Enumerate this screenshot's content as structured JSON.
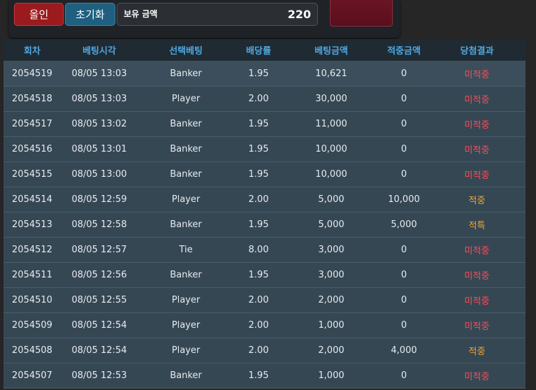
{
  "controls": {
    "allin_label": "올인",
    "reset_label": "초기화",
    "balance_label": "보유 금액",
    "balance_value": "220",
    "bet_label": ""
  },
  "colors": {
    "allin_button": "#9a1a1d",
    "reset_button": "#1f5f80",
    "bet_button": "#6a1424",
    "header_text": "#4fa8e0",
    "loss_text": "#ff4a55",
    "win_text": "#f0a531"
  },
  "table": {
    "headers": [
      "회차",
      "베팅시각",
      "선택베팅",
      "배당률",
      "베팅금액",
      "적중금액",
      "당첨결과"
    ],
    "rows": [
      {
        "round": "2054519",
        "time": "08/05 13:03",
        "choice": "Banker",
        "odds": "1.95",
        "amount": "10,621",
        "win": "0",
        "result": "미적중",
        "status": "lose"
      },
      {
        "round": "2054518",
        "time": "08/05 13:03",
        "choice": "Player",
        "odds": "2.00",
        "amount": "30,000",
        "win": "0",
        "result": "미적중",
        "status": "lose"
      },
      {
        "round": "2054517",
        "time": "08/05 13:02",
        "choice": "Banker",
        "odds": "1.95",
        "amount": "11,000",
        "win": "0",
        "result": "미적중",
        "status": "lose"
      },
      {
        "round": "2054516",
        "time": "08/05 13:01",
        "choice": "Banker",
        "odds": "1.95",
        "amount": "10,000",
        "win": "0",
        "result": "미적중",
        "status": "lose"
      },
      {
        "round": "2054515",
        "time": "08/05 13:00",
        "choice": "Banker",
        "odds": "1.95",
        "amount": "10,000",
        "win": "0",
        "result": "미적중",
        "status": "lose"
      },
      {
        "round": "2054514",
        "time": "08/05 12:59",
        "choice": "Player",
        "odds": "2.00",
        "amount": "5,000",
        "win": "10,000",
        "result": "적중",
        "status": "win"
      },
      {
        "round": "2054513",
        "time": "08/05 12:58",
        "choice": "Banker",
        "odds": "1.95",
        "amount": "5,000",
        "win": "5,000",
        "result": "적특",
        "status": "special"
      },
      {
        "round": "2054512",
        "time": "08/05 12:57",
        "choice": "Tie",
        "odds": "8.00",
        "amount": "3,000",
        "win": "0",
        "result": "미적중",
        "status": "lose"
      },
      {
        "round": "2054511",
        "time": "08/05 12:56",
        "choice": "Banker",
        "odds": "1.95",
        "amount": "3,000",
        "win": "0",
        "result": "미적중",
        "status": "lose"
      },
      {
        "round": "2054510",
        "time": "08/05 12:55",
        "choice": "Player",
        "odds": "2.00",
        "amount": "2,000",
        "win": "0",
        "result": "미적중",
        "status": "lose"
      },
      {
        "round": "2054509",
        "time": "08/05 12:54",
        "choice": "Player",
        "odds": "2.00",
        "amount": "1,000",
        "win": "0",
        "result": "미적중",
        "status": "lose"
      },
      {
        "round": "2054508",
        "time": "08/05 12:54",
        "choice": "Player",
        "odds": "2.00",
        "amount": "2,000",
        "win": "4,000",
        "result": "적중",
        "status": "win"
      },
      {
        "round": "2054507",
        "time": "08/05 12:53",
        "choice": "Banker",
        "odds": "1.95",
        "amount": "1,000",
        "win": "0",
        "result": "미적중",
        "status": "lose"
      }
    ]
  }
}
